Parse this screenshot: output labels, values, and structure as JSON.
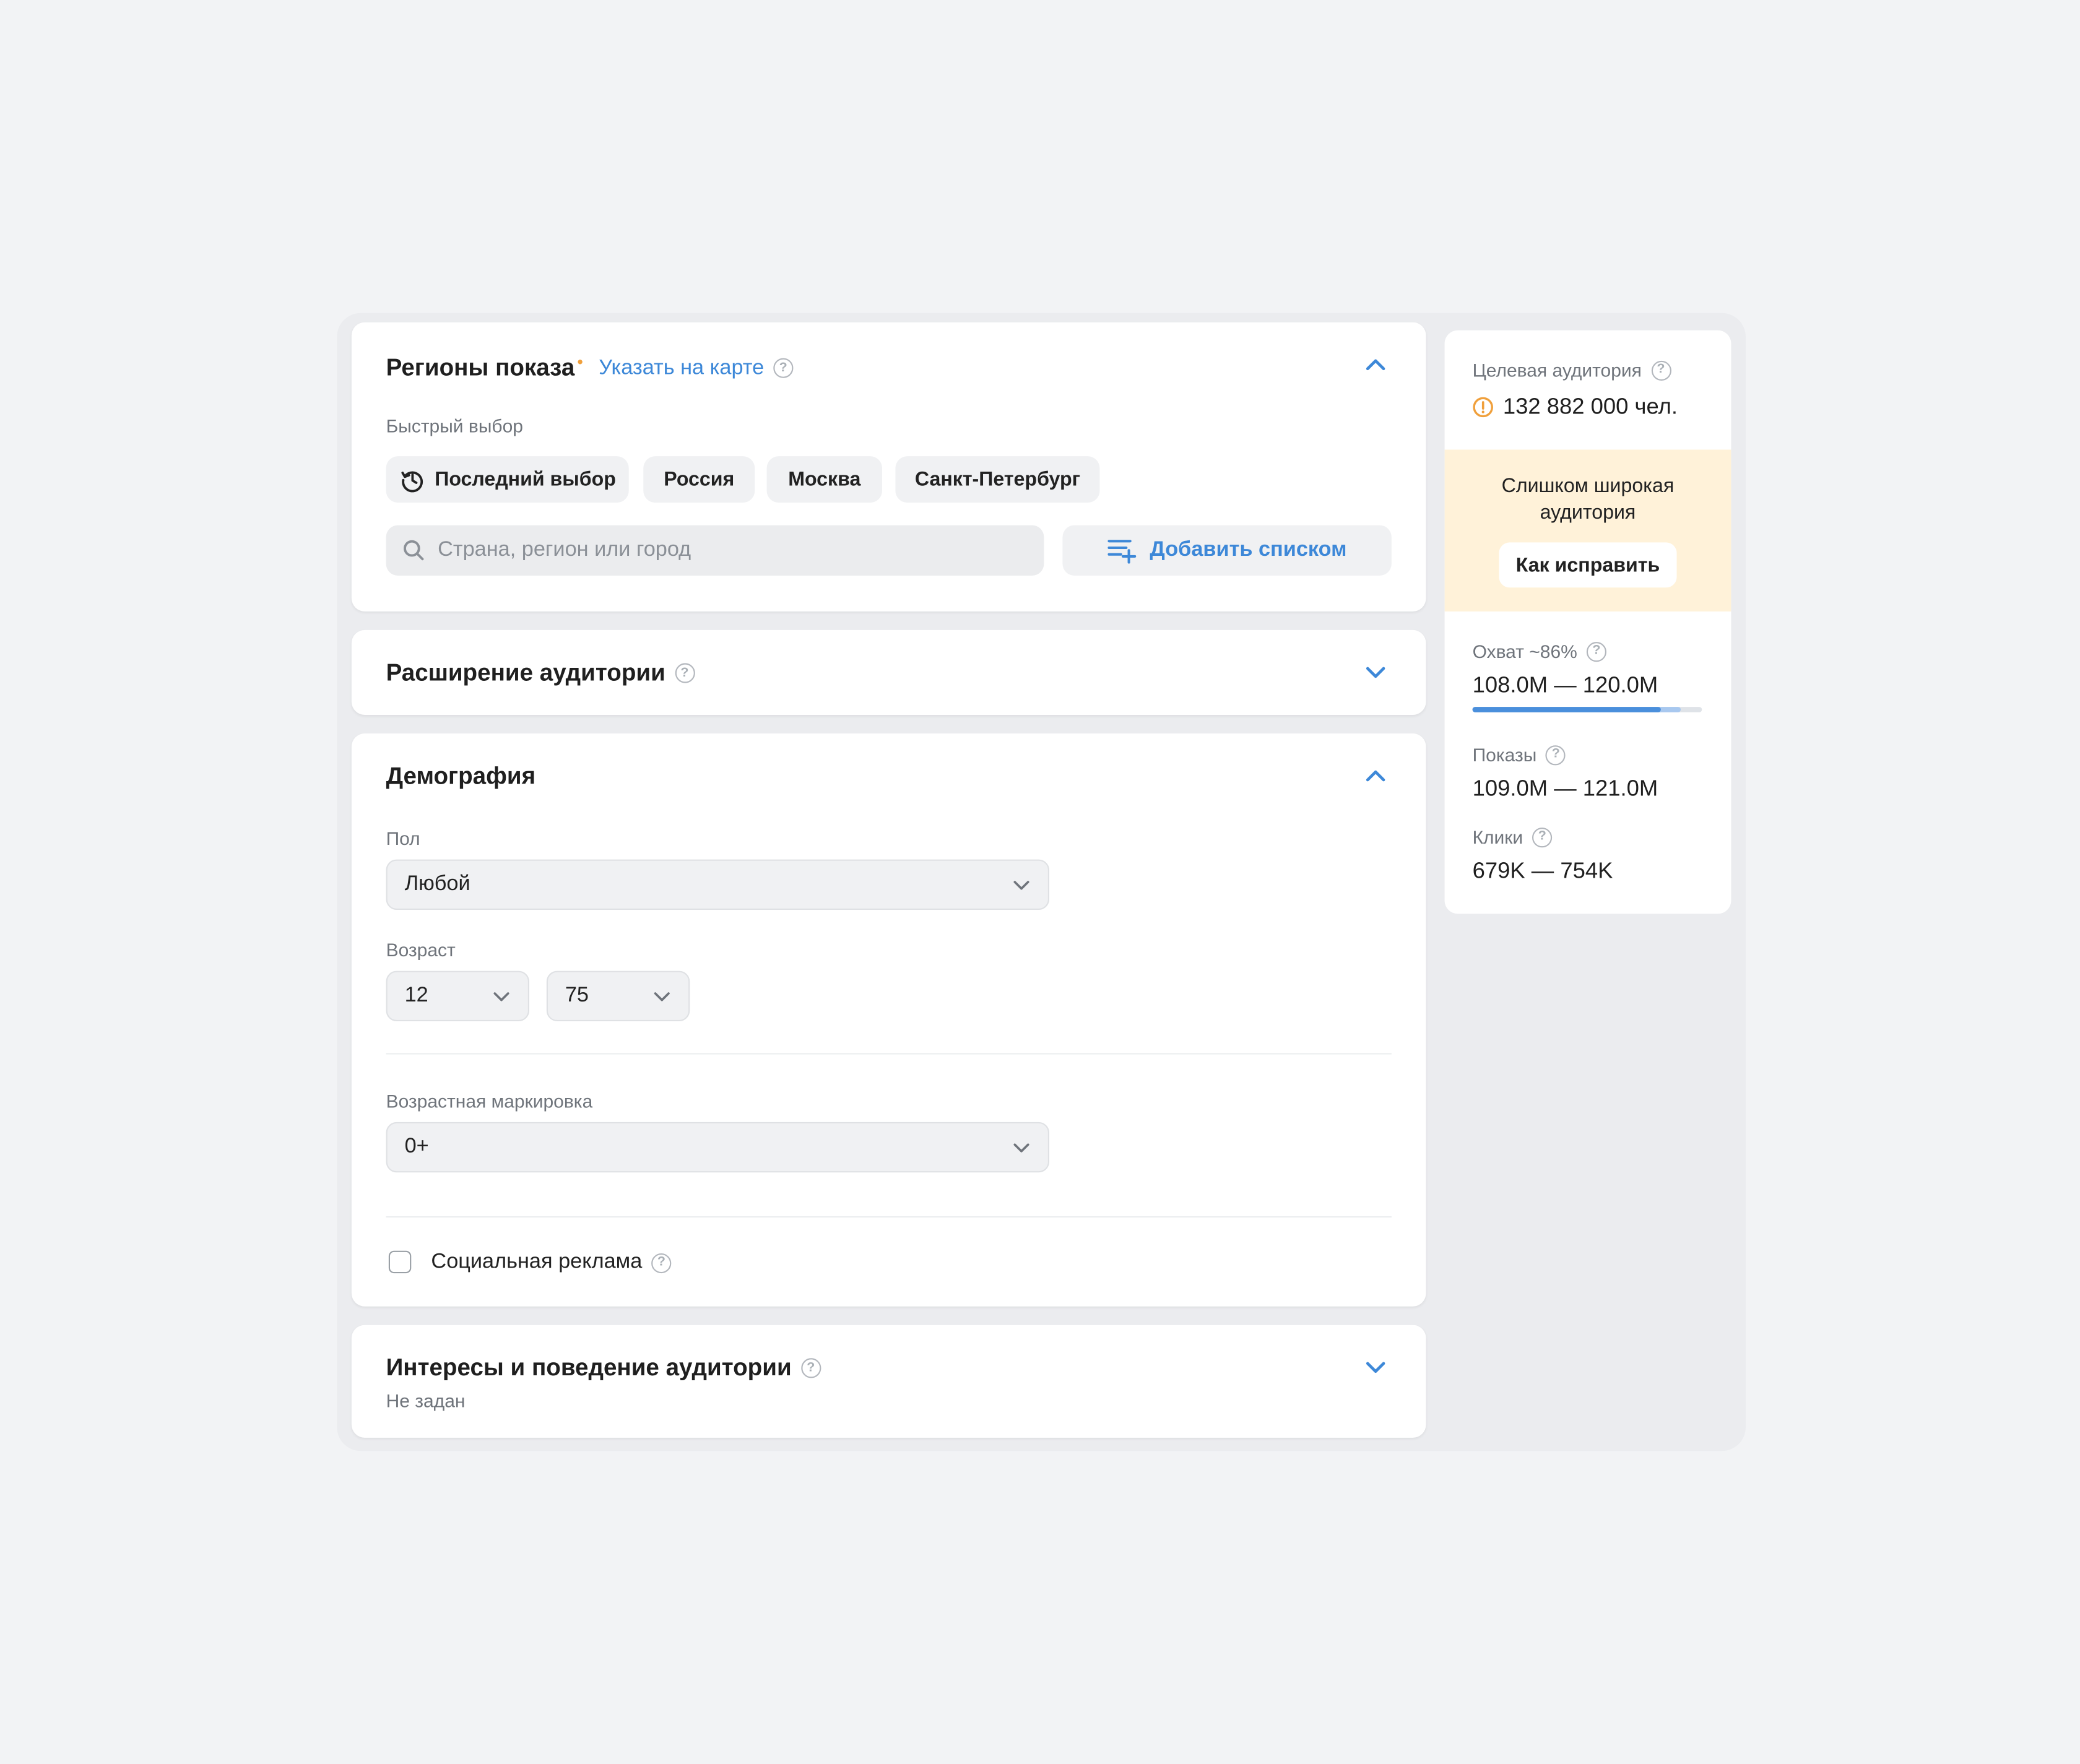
{
  "regions": {
    "title": "Регионы показа",
    "required_mark": "•",
    "map_link": "Указать на карте",
    "quick_label": "Быстрый выбор",
    "chips": [
      "Последний выбор",
      "Россия",
      "Москва",
      "Санкт-Петербург"
    ],
    "search_placeholder": "Страна, регион или город",
    "add_list_label": "Добавить списком"
  },
  "expansion": {
    "title": "Расширение аудитории"
  },
  "demography": {
    "title": "Демография",
    "gender_label": "Пол",
    "gender_value": "Любой",
    "age_label": "Возраст",
    "age_from": "12",
    "age_to": "75",
    "age_marking_label": "Возрастная маркировка",
    "age_marking_value": "0+",
    "social_label": "Социальная реклама"
  },
  "interests": {
    "title": "Интересы и поведение аудитории",
    "subtitle": "Не задан"
  },
  "sidebar": {
    "audience_label": "Целевая аудитория",
    "audience_value": "132 882 000 чел.",
    "warning_text": "Слишком широкая аудитория",
    "fix_button": "Как исправить",
    "reach_label": "Охват ~86%",
    "reach_value": "108.0M — 120.0M",
    "reach_progress_low": 0.82,
    "reach_progress_high": 0.91,
    "impressions_label": "Показы",
    "impressions_value": "109.0M — 121.0M",
    "clicks_label": "Клики",
    "clicks_value": "679K — 754K"
  },
  "colors": {
    "accent": "#3d88d8",
    "warning": "#f0a03c",
    "warning_bg": "#fff2d9"
  },
  "icons": {
    "help": "question-circle-icon",
    "collapse": "chevron-up-icon",
    "expand": "chevron-down-icon",
    "history": "history-icon",
    "search": "search-icon",
    "add_list": "list-add-icon",
    "warning": "warning-circle-icon"
  }
}
